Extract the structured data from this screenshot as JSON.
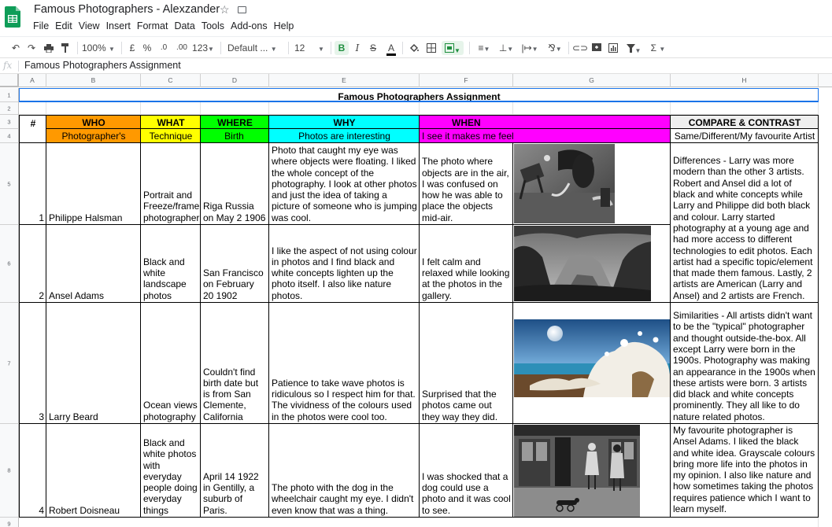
{
  "app": {
    "doc_title": "Famous Photographers - Alexzander",
    "menu": [
      "File",
      "Edit",
      "View",
      "Insert",
      "Format",
      "Data",
      "Tools",
      "Add-ons",
      "Help"
    ]
  },
  "toolbar": {
    "zoom": "100%",
    "currency": "£",
    "percent": "%",
    "dec_less": ".0",
    "dec_more": ".00",
    "more_formats": "123",
    "font": "Default ...",
    "font_size": "12",
    "bold": "B",
    "italic": "I",
    "strike": "S",
    "text_color": "A",
    "functions": "Σ"
  },
  "formula_bar": {
    "fx": "fx",
    "value": "Famous Photographers Assignment"
  },
  "columns": [
    "A",
    "B",
    "C",
    "D",
    "E",
    "F",
    "G",
    "H"
  ],
  "rows": [
    "1",
    "2",
    "3",
    "4",
    "5",
    "6",
    "7",
    "8",
    "9"
  ],
  "sheet": {
    "title": "Famous Photographers Assignment",
    "headers": {
      "num": "#",
      "who": "WHO",
      "what": "WHAT",
      "where": "WHERE",
      "why": "WHY",
      "when": "WHEN",
      "compare": "COMPARE & CONTRAST"
    },
    "subheaders": {
      "who": "Photographer's Name",
      "what": "Technique",
      "where": "Birth date/place",
      "why": "Photos are interesting",
      "when": "I see it makes me feel",
      "compare": "Same/Different/My favourite Artist"
    },
    "rows": [
      {
        "num": "1",
        "name": "Philippe Halsman",
        "technique": "Portrait and Freeze/frame photographer",
        "birth": "Riga Russia on May 2 1906",
        "why": "Photo that caught my eye was where objects were floating. I liked the whole concept of the photography. I look at other photos and just the idea of taking a picture of someone who is jumping was cool.",
        "when": "The photo where objects are in the air, I was confused on how he was able to place the objects mid-air."
      },
      {
        "num": "2",
        "name": "Ansel Adams",
        "technique": "Black and white landscape photos",
        "birth": "San Francisco on February 20 1902",
        "why": "I like the aspect of not using colour in photos and I find black and white concepts lighten up the photo itself. I also like nature photos.",
        "when": "I felt calm and relaxed while looking at the photos in the gallery."
      },
      {
        "num": "3",
        "name": "Larry Beard",
        "technique": "Ocean views photography",
        "birth": "Couldn't find birth date but is from San Clemente, California",
        "why": "Patience to take wave photos is ridiculous so I respect him for that. The vividness of the colours used in the photos were cool too.",
        "when": "Surprised that the photos came out they way they did."
      },
      {
        "num": "4",
        "name": "Robert Doisneau",
        "technique": "Black and white photos with everyday people doing everyday things",
        "birth": "April 14 1922 in Gentilly, a suburb of Paris.",
        "why": "The photo with the dog in the wheelchair caught my eye. I didn't even know that was a thing.",
        "when": "I was shocked that a dog could use a photo and it was cool to see."
      }
    ],
    "compare": {
      "differences": "Differences - Larry was more modern than the other 3 artists. Robert and Ansel did a lot of black and white concepts while Larry and Philippe did both black and colour. Larry started photography at a young age and had more access to different technologies to edit photos. Each artist had a specific topic/element that made them famous. Lastly, 2 artists are American (Larry and Ansel) and 2 artists are French.",
      "similarities": "Similarities - All artists didn't want to be the \"typical\" photographer and thought outside-the-box. All except Larry were born in the 1900s. Photography was making an appearance in the 1900s when these artists were born. 3 artists did black and white concepts prominently. They all like to do nature related photos.",
      "favourite": "My favourite photographer is Ansel Adams. I liked the black and white idea. Grayscale colours bring more life into the photos in my opinion. I also like nature and how sometimes taking the photos requires patience which I want to learn myself."
    },
    "colors": {
      "who": "#ff9900",
      "what": "#ffff00",
      "where": "#00ff00",
      "why": "#00ffff",
      "when": "#ff00ff",
      "compare": "#efefef",
      "title_border": "#1a73e8"
    }
  }
}
